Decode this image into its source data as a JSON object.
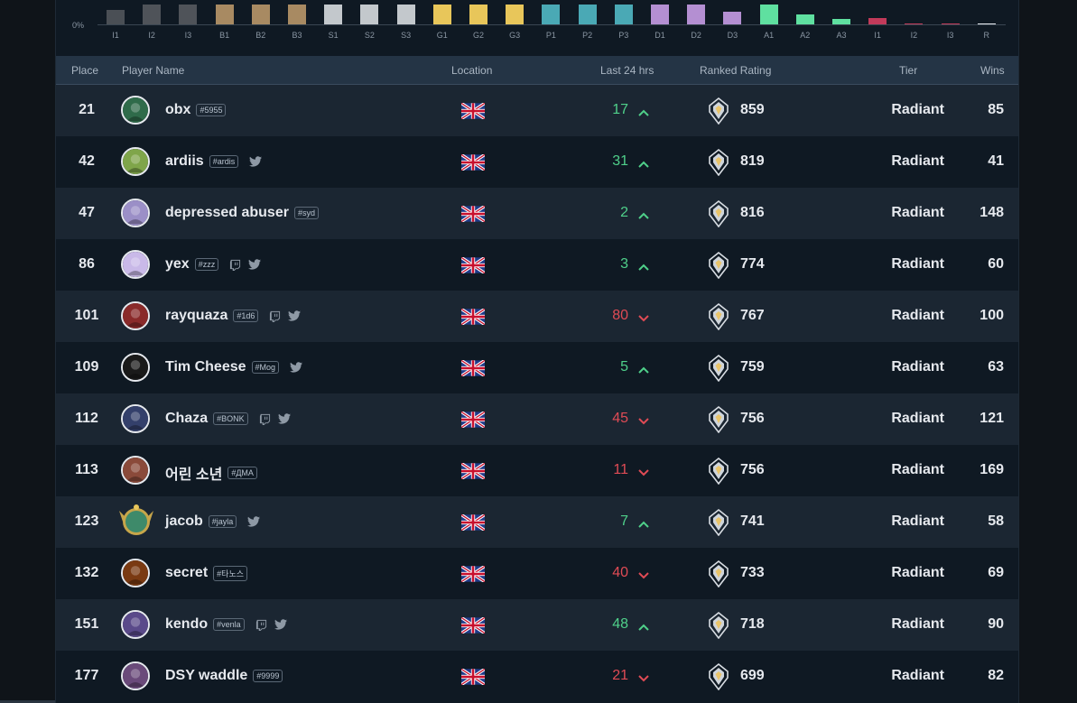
{
  "chart": {
    "ylabel": "0%",
    "bars": [
      {
        "label": "I1",
        "value": 0.8,
        "color": "#4a4f55"
      },
      {
        "label": "I2",
        "value": 1.1,
        "color": "#4f5359"
      },
      {
        "label": "I3",
        "value": 1.1,
        "color": "#4f5359"
      },
      {
        "label": "B1",
        "value": 1.1,
        "color": "#a88a62"
      },
      {
        "label": "B2",
        "value": 1.1,
        "color": "#a88a62"
      },
      {
        "label": "B3",
        "value": 1.1,
        "color": "#a88a62"
      },
      {
        "label": "S1",
        "value": 1.1,
        "color": "#c3c8cc"
      },
      {
        "label": "S2",
        "value": 1.1,
        "color": "#c3c8cc"
      },
      {
        "label": "S3",
        "value": 1.1,
        "color": "#c3c8cc"
      },
      {
        "label": "G1",
        "value": 1.1,
        "color": "#e8c65a"
      },
      {
        "label": "G2",
        "value": 1.1,
        "color": "#e8c65a"
      },
      {
        "label": "G3",
        "value": 1.1,
        "color": "#e8c65a"
      },
      {
        "label": "P1",
        "value": 1.1,
        "color": "#4aa9b5"
      },
      {
        "label": "P2",
        "value": 1.1,
        "color": "#4aa9b5"
      },
      {
        "label": "P3",
        "value": 1.1,
        "color": "#4aa9b5"
      },
      {
        "label": "D1",
        "value": 1.1,
        "color": "#b48fd2"
      },
      {
        "label": "D2",
        "value": 1.1,
        "color": "#b48fd2"
      },
      {
        "label": "D3",
        "value": 0.7,
        "color": "#b48fd2"
      },
      {
        "label": "A1",
        "value": 1.1,
        "color": "#5fe0a0"
      },
      {
        "label": "A2",
        "value": 0.55,
        "color": "#5fe0a0"
      },
      {
        "label": "A3",
        "value": 0.3,
        "color": "#5fe0a0"
      },
      {
        "label": "I1",
        "value": 0.35,
        "color": "#c23a5a"
      },
      {
        "label": "I2",
        "value": 0.05,
        "color": "#c23a5a"
      },
      {
        "label": "I3",
        "value": 0.05,
        "color": "#c23a5a"
      },
      {
        "label": "R",
        "value": 0.05,
        "color": "#e6e9ee"
      }
    ]
  },
  "table": {
    "headers": {
      "place": "Place",
      "player": "Player Name",
      "location": "Location",
      "last24": "Last 24 hrs",
      "rating": "Ranked Rating",
      "tier": "Tier",
      "wins": "Wins"
    },
    "rows": [
      {
        "place": "21",
        "name": "obx",
        "tag": "#5955",
        "twitch": false,
        "twitter": false,
        "delta": "17",
        "trend": "up",
        "rating": "859",
        "tier": "Radiant",
        "wins": "85",
        "avatar_color": "#2f6b4a",
        "frame": false
      },
      {
        "place": "42",
        "name": "ardiis",
        "tag": "#ardis",
        "twitch": false,
        "twitter": true,
        "delta": "31",
        "trend": "up",
        "rating": "819",
        "tier": "Radiant",
        "wins": "41",
        "avatar_color": "#7fa54a",
        "frame": false
      },
      {
        "place": "47",
        "name": "depressed abuser",
        "tag": "#syd",
        "twitch": false,
        "twitter": false,
        "delta": "2",
        "trend": "up",
        "rating": "816",
        "tier": "Radiant",
        "wins": "148",
        "avatar_color": "#9b8fc7",
        "frame": false
      },
      {
        "place": "86",
        "name": "yex",
        "tag": "#zzz",
        "twitch": true,
        "twitter": true,
        "delta": "3",
        "trend": "up",
        "rating": "774",
        "tier": "Radiant",
        "wins": "60",
        "avatar_color": "#c9b9e8",
        "frame": false
      },
      {
        "place": "101",
        "name": "rayquaza",
        "tag": "#1d6",
        "twitch": true,
        "twitter": true,
        "delta": "80",
        "trend": "down",
        "rating": "767",
        "tier": "Radiant",
        "wins": "100",
        "avatar_color": "#8a2a2a",
        "frame": false
      },
      {
        "place": "109",
        "name": "Tim Cheese",
        "tag": "#Mog",
        "twitch": false,
        "twitter": true,
        "delta": "5",
        "trend": "up",
        "rating": "759",
        "tier": "Radiant",
        "wins": "63",
        "avatar_color": "#1a1a1a",
        "frame": false
      },
      {
        "place": "112",
        "name": "Chaza",
        "tag": "#BONK",
        "twitch": true,
        "twitter": true,
        "delta": "45",
        "trend": "down",
        "rating": "756",
        "tier": "Radiant",
        "wins": "121",
        "avatar_color": "#34406b",
        "frame": false
      },
      {
        "place": "113",
        "name": "어린 소년",
        "tag": "#ДМА",
        "twitch": false,
        "twitter": false,
        "delta": "11",
        "trend": "down",
        "rating": "756",
        "tier": "Radiant",
        "wins": "169",
        "avatar_color": "#8a4a3a",
        "frame": false
      },
      {
        "place": "123",
        "name": "jacob",
        "tag": "#jayla",
        "twitch": false,
        "twitter": true,
        "delta": "7",
        "trend": "up",
        "rating": "741",
        "tier": "Radiant",
        "wins": "58",
        "avatar_color": "#3e8a6a",
        "frame": true
      },
      {
        "place": "132",
        "name": "secret",
        "tag": "#타노스",
        "twitch": false,
        "twitter": false,
        "delta": "40",
        "trend": "down",
        "rating": "733",
        "tier": "Radiant",
        "wins": "69",
        "avatar_color": "#7a3a12",
        "frame": false
      },
      {
        "place": "151",
        "name": "kendo",
        "tag": "#venla",
        "twitch": true,
        "twitter": true,
        "delta": "48",
        "trend": "up",
        "rating": "718",
        "tier": "Radiant",
        "wins": "90",
        "avatar_color": "#5a4a8a",
        "frame": false
      },
      {
        "place": "177",
        "name": "DSY waddle",
        "tag": "#9999",
        "twitch": false,
        "twitter": false,
        "delta": "21",
        "trend": "down",
        "rating": "699",
        "tier": "Radiant",
        "wins": "82",
        "avatar_color": "#6a4a7a",
        "frame": false
      }
    ]
  },
  "colors": {
    "up": "#4fd08a",
    "down": "#e04b55"
  }
}
